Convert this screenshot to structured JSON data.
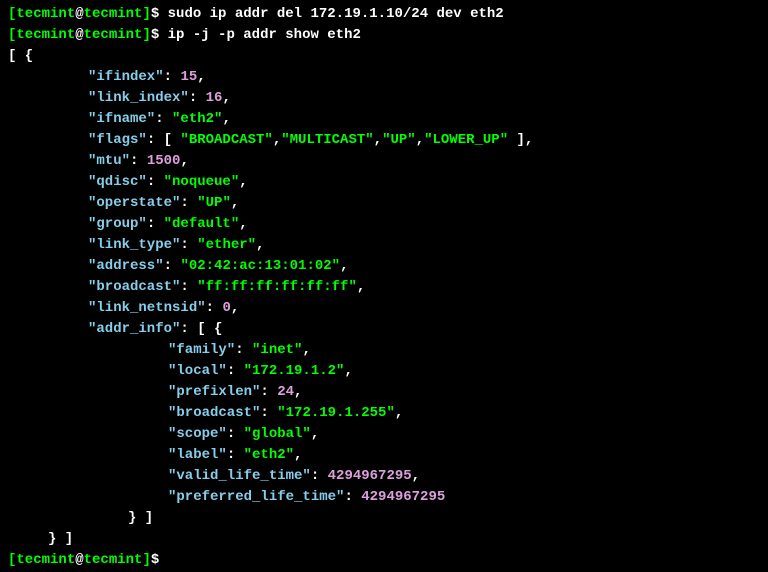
{
  "prompt": {
    "open_bracket": "[",
    "user": "tecmint",
    "at": "@",
    "host": "tecmint",
    "close_bracket": "]",
    "dollar": "$"
  },
  "commands": {
    "cmd1": " sudo ip addr del 172.19.1.10/24 dev eth2",
    "cmd2": " ip -j -p addr show eth2"
  },
  "json_output": {
    "open": "[ {",
    "lines": [
      {
        "key": "\"ifindex\"",
        "colon": ": ",
        "value": "15",
        "comma": ",",
        "type": "number"
      },
      {
        "key": "\"link_index\"",
        "colon": ": ",
        "value": "16",
        "comma": ",",
        "type": "number"
      },
      {
        "key": "\"ifname\"",
        "colon": ": ",
        "value": "\"eth2\"",
        "comma": ",",
        "type": "string"
      },
      {
        "key": "\"flags\"",
        "colon": ": ",
        "raw": "[ \"BROADCAST\",\"MULTICAST\",\"UP\",\"LOWER_UP\" ],",
        "flags": [
          "\"BROADCAST\"",
          "\"MULTICAST\"",
          "\"UP\"",
          "\"LOWER_UP\""
        ]
      },
      {
        "key": "\"mtu\"",
        "colon": ": ",
        "value": "1500",
        "comma": ",",
        "type": "number"
      },
      {
        "key": "\"qdisc\"",
        "colon": ": ",
        "value": "\"noqueue\"",
        "comma": ",",
        "type": "string"
      },
      {
        "key": "\"operstate\"",
        "colon": ": ",
        "value": "\"UP\"",
        "comma": ",",
        "type": "string"
      },
      {
        "key": "\"group\"",
        "colon": ": ",
        "value": "\"default\"",
        "comma": ",",
        "type": "string"
      },
      {
        "key": "\"link_type\"",
        "colon": ": ",
        "value": "\"ether\"",
        "comma": ",",
        "type": "string"
      },
      {
        "key": "\"address\"",
        "colon": ": ",
        "value": "\"02:42:ac:13:01:02\"",
        "comma": ",",
        "type": "string"
      },
      {
        "key": "\"broadcast\"",
        "colon": ": ",
        "value": "\"ff:ff:ff:ff:ff:ff\"",
        "comma": ",",
        "type": "string"
      },
      {
        "key": "\"link_netnsid\"",
        "colon": ": ",
        "value": "0",
        "comma": ",",
        "type": "number"
      },
      {
        "key": "\"addr_info\"",
        "colon": ": ",
        "raw": "[ {",
        "type": "open"
      }
    ],
    "addr_info": [
      {
        "key": "\"family\"",
        "colon": ": ",
        "value": "\"inet\"",
        "comma": ",",
        "type": "string"
      },
      {
        "key": "\"local\"",
        "colon": ": ",
        "value": "\"172.19.1.2\"",
        "comma": ",",
        "type": "string"
      },
      {
        "key": "\"prefixlen\"",
        "colon": ": ",
        "value": "24",
        "comma": ",",
        "type": "number"
      },
      {
        "key": "\"broadcast\"",
        "colon": ": ",
        "value": "\"172.19.1.255\"",
        "comma": ",",
        "type": "string"
      },
      {
        "key": "\"scope\"",
        "colon": ": ",
        "value": "\"global\"",
        "comma": ",",
        "type": "string"
      },
      {
        "key": "\"label\"",
        "colon": ": ",
        "value": "\"eth2\"",
        "comma": ",",
        "type": "string"
      },
      {
        "key": "\"valid_life_time\"",
        "colon": ": ",
        "value": "4294967295",
        "comma": ",",
        "type": "number"
      },
      {
        "key": "\"preferred_life_time\"",
        "colon": ": ",
        "value": "4294967295",
        "comma": "",
        "type": "number"
      }
    ],
    "close_addr": "} ]",
    "close_obj": "} ]"
  }
}
